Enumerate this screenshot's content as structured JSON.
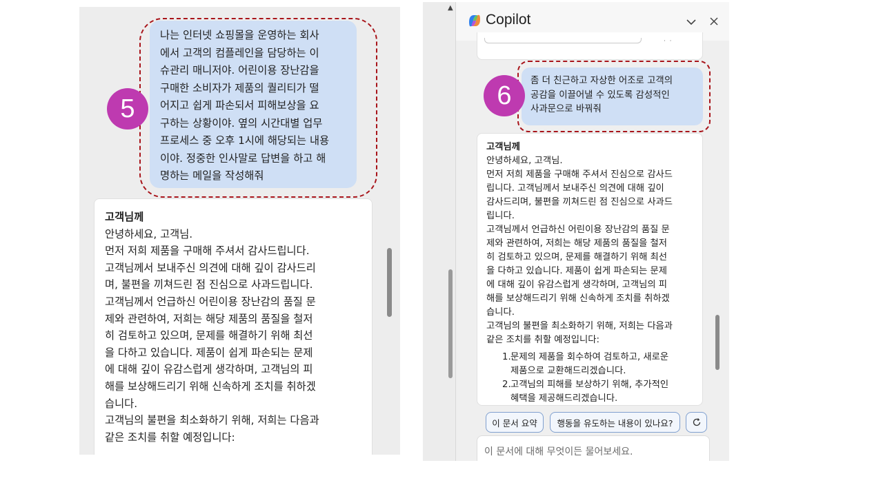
{
  "left": {
    "step_number": "5",
    "user_message_lines": [
      "나는 인터넷 쇼핑몰을 운영하는 회사",
      "에서 고객의 컴플레인을 담당하는 이",
      "슈관리 매니저야. 어린이용 장난감을",
      "구매한 소비자가 제품의 퀄리티가 떨",
      "어지고 쉽게 파손되서 피해보상을 요",
      "구하는 상황이야. 옆의 시간대별 업무",
      "프로세스 중 오후 1시에 해당되는 내용",
      "이야. 정중한 인사말로 답변을 하고 해",
      "명하는 메일을 작성해줘"
    ],
    "reply_title": "고객님께",
    "reply_lines": [
      "안녕하세요, 고객님.",
      "먼저 저희 제품을 구매해 주셔서 감사드립니다.",
      "고객님께서 보내주신 의견에 대해 깊이 감사드리",
      "며, 불편을 끼쳐드린 점 진심으로 사과드립니다.",
      "고객님께서 언급하신 어린이용 장난감의 품질 문",
      "제와 관련하여, 저희는 해당 제품의 품질을 철저",
      "히 검토하고 있으며, 문제를 해결하기 위해 최선",
      "을 다하고 있습니다. 제품이 쉽게 파손되는 문제",
      "에 대해 깊이 유감스럽게 생각하며, 고객님의 피",
      "해를 보상해드리기 위해 신속하게 조치를 취하겠",
      "습니다.",
      "고객님의 불편을 최소화하기 위해, 저희는 다음과",
      "같은 조치를 취할 예정입니다:"
    ]
  },
  "right": {
    "header_title": "Copilot",
    "step_number": "6",
    "user_message_lines": [
      "좀 더 친근하고 자상한 어조로 고객의",
      "공감을 이끌어낼 수 있도록 감성적인",
      "사과문으로 바꿔줘"
    ],
    "reply_title": "고객님께",
    "reply_lines": [
      "안녕하세요, 고객님.",
      "먼저 저희 제품을 구매해 주셔서 진심으로 감사드",
      "립니다. 고객님께서 보내주신 의견에 대해 깊이",
      "감사드리며, 불편을 끼쳐드린 점 진심으로 사과드",
      "립니다.",
      "고객님께서 언급하신 어린이용 장난감의 품질 문",
      "제와 관련하여, 저희는 해당 제품의 품질을 철저",
      "히 검토하고 있으며, 문제를 해결하기 위해 최선",
      "을 다하고 있습니다. 제품이 쉽게 파손되는 문제",
      "에 대해 깊이 유감스럽게 생각하며, 고객님의 피",
      "해를 보상해드리기 위해 신속하게 조치를 취하겠",
      "습니다.",
      "고객님의 불편을 최소화하기 위해, 저희는 다음과",
      "같은 조치를 취할 예정입니다:"
    ],
    "list_items": [
      {
        "num": "1.",
        "lines": [
          "문제의 제품을 회수하여 검토하고, 새로운",
          "제품으로 교환해드리겠습니다."
        ]
      },
      {
        "num": "2.",
        "lines": [
          "고객님의 피해를 보상하기 위해, 추가적인",
          "혜택을 제공해드리겠습니다."
        ]
      }
    ],
    "suggestions": [
      "이 문서 요약",
      "행동을 유도하는 내용이 있나요?"
    ],
    "input_placeholder": "이 문서에 대해 무엇이든 물어보세요."
  },
  "colors": {
    "user_bubble": "#cfdff5",
    "badge": "#be3ab0",
    "dashed_outline": "#a8141a",
    "suggestion_border": "#7f9fcf"
  },
  "icons": [
    "copilot-logo-icon",
    "chevron-down-icon",
    "close-icon",
    "refresh-icon"
  ]
}
